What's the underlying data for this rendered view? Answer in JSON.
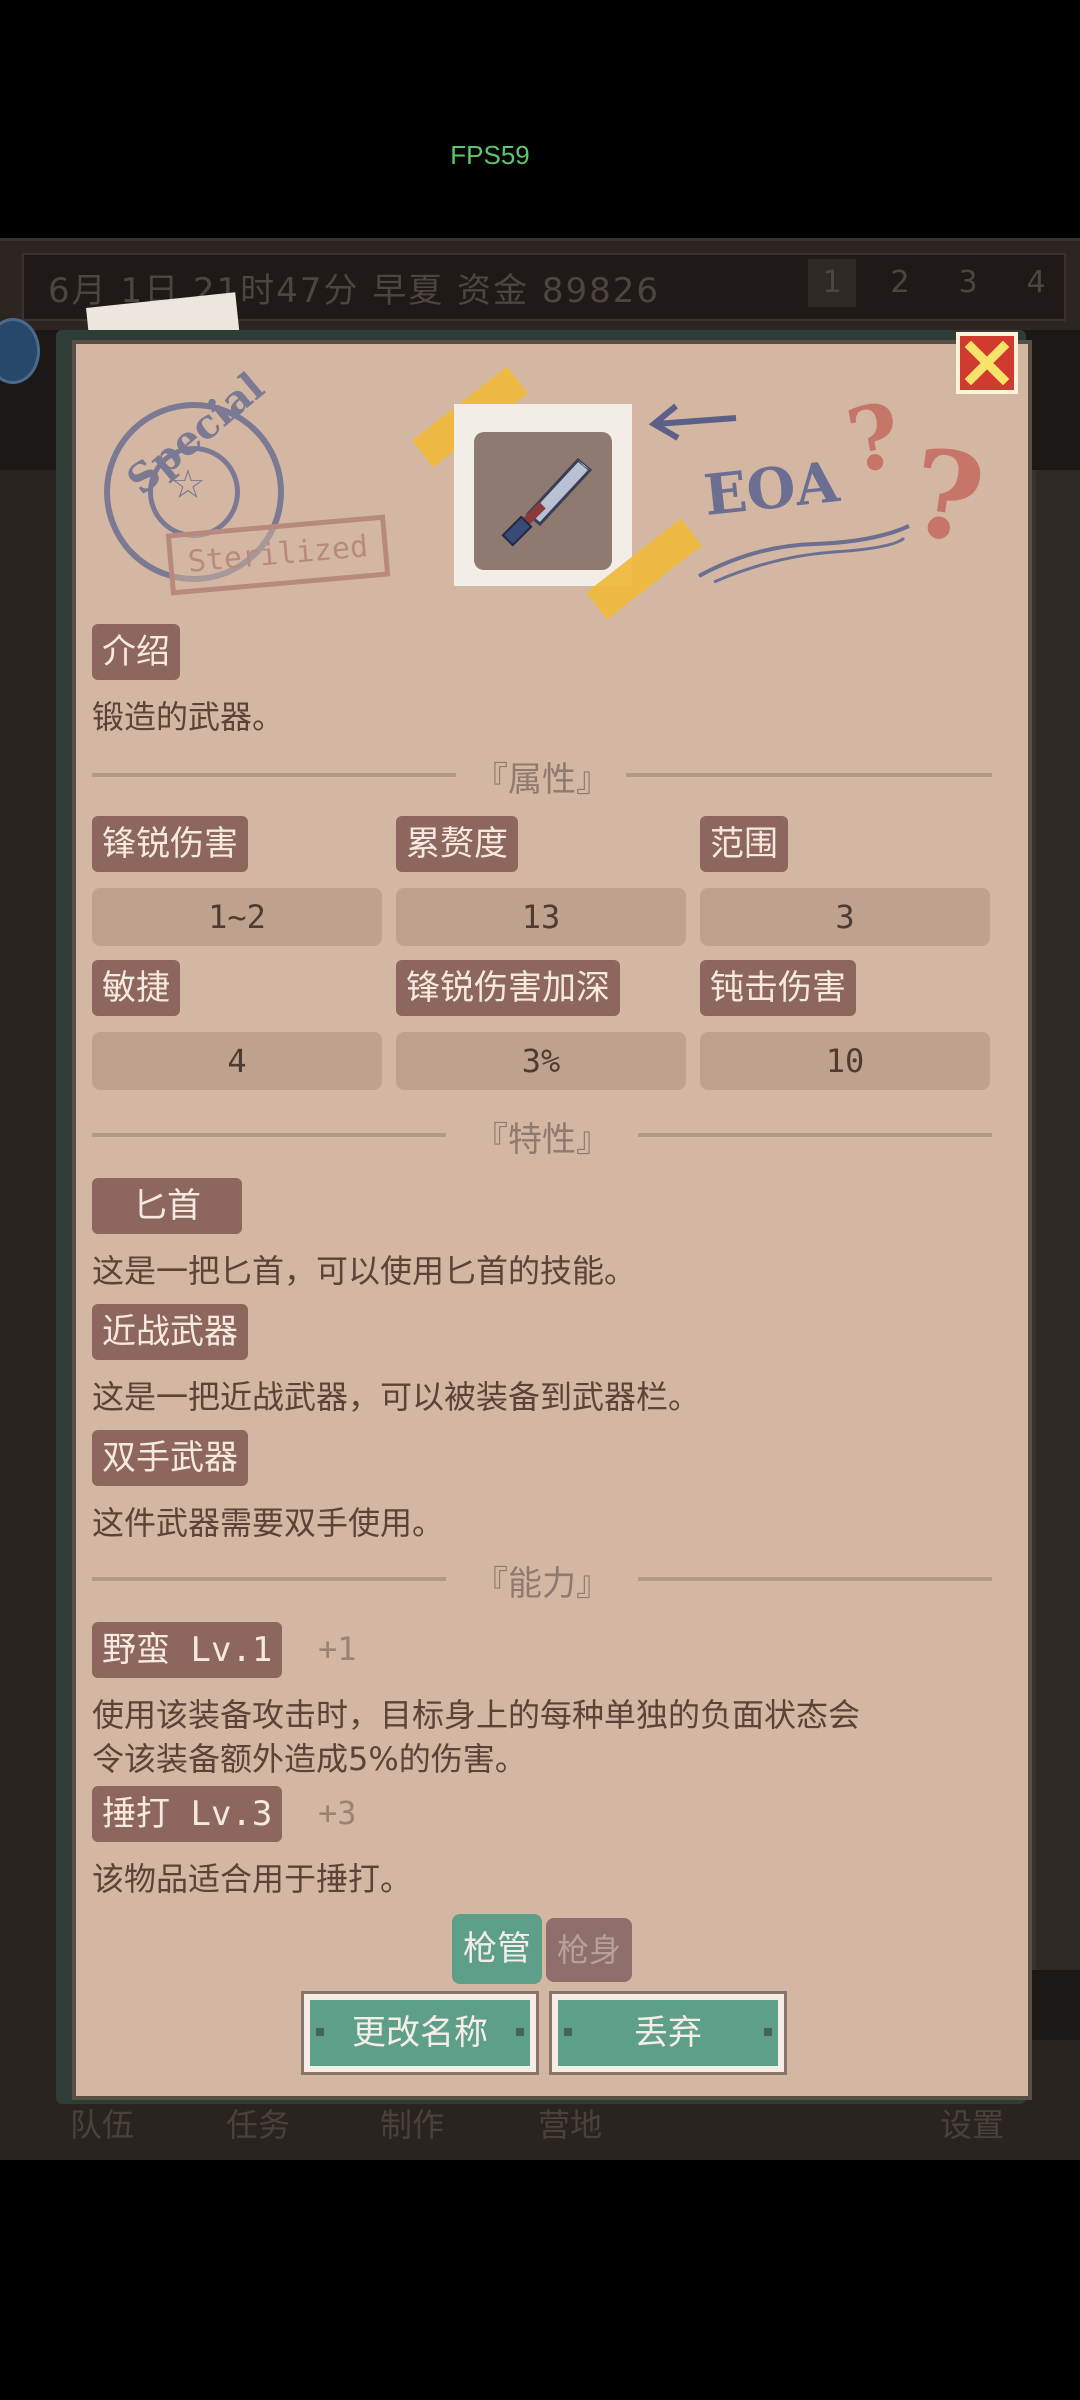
{
  "fps": "FPS59",
  "topbar": {
    "date": "6月 1日 21时47分 早夏 资金 89826",
    "pages": [
      "1",
      "2",
      "3",
      "4"
    ]
  },
  "bottomnav": [
    "队伍",
    "任务",
    "制作",
    "营地",
    "设置"
  ],
  "stamps": {
    "special_text": "Special",
    "sterilized_text": "Sterilized",
    "eoa_text": "EOA",
    "question_marks": "??"
  },
  "item": {
    "icon": "dagger-icon"
  },
  "intro": {
    "tag": "介绍",
    "text": "锻造的武器。"
  },
  "attributes": {
    "section_title": "『属性』",
    "stats": [
      {
        "label": "锋锐伤害",
        "value": "1~2"
      },
      {
        "label": "累赘度",
        "value": "13"
      },
      {
        "label": "范围",
        "value": "3"
      },
      {
        "label": "敏捷",
        "value": "4"
      },
      {
        "label": "锋锐伤害加深",
        "value": "3%"
      },
      {
        "label": "钝击伤害",
        "value": "10"
      }
    ]
  },
  "traits": {
    "section_title": "『特性』",
    "items": [
      {
        "tag": "匕首",
        "text": "这是一把匕首，可以使用匕首的技能。"
      },
      {
        "tag": "近战武器",
        "text": "这是一把近战武器，可以被装备到武器栏。"
      },
      {
        "tag": "双手武器",
        "text": "这件武器需要双手使用。"
      }
    ]
  },
  "abilities": {
    "section_title": "『能力』",
    "items": [
      {
        "tag": "野蛮 Lv.1",
        "extra": "+1",
        "lines": [
          "使用该装备攻击时，目标身上的每种单独的负面状态会",
          "令该装备额外造成5%的伤害。"
        ]
      },
      {
        "tag": "捶打 Lv.3",
        "extra": "+3",
        "lines": [
          "该物品适合用于捶打。"
        ]
      }
    ]
  },
  "toggles": {
    "on": "枪管",
    "off": "枪身"
  },
  "buttons": {
    "rename": "更改名称",
    "discard": "丢弃"
  },
  "colors": {
    "accent": "#5e9f8a",
    "tag": "#8d665e",
    "card": "#d4b7a2",
    "close": "#d13a2f"
  }
}
